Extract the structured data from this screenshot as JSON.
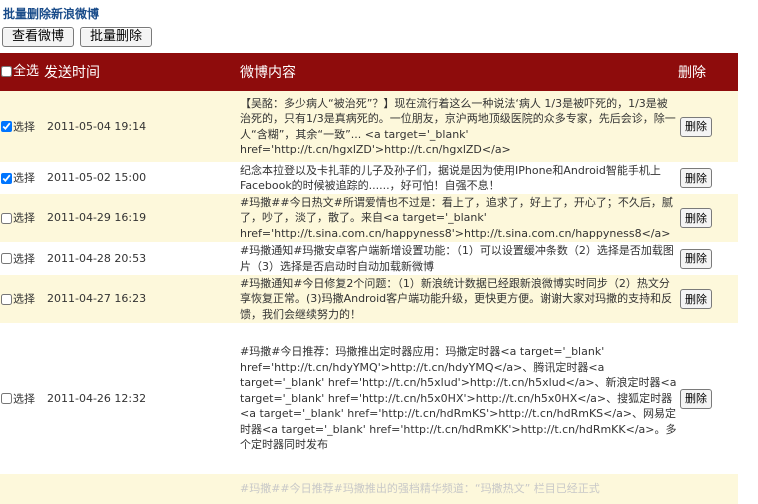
{
  "page": {
    "title": "批量删除新浪微博"
  },
  "toolbar": {
    "view_label": "查看微博",
    "batch_delete_label": "批量删除"
  },
  "table": {
    "headers": {
      "select_all": "全选",
      "time": "发送时间",
      "content": "微博内容",
      "delete": "删除"
    },
    "select_label": "选择",
    "delete_label": "删除",
    "rows": [
      {
        "checked": true,
        "time": "2011-05-04 19:14",
        "content": "【吴酩：多少病人“被治死”？】现在流行着这么一种说法‘病人 1/3是被吓死的，1/3是被治死的，只有1/3是真病死的。一位朋友，京沪两地顶级医院的众多专家，先后会诊，除一人“含糊”，其余“一致”... <a target='_blank' href='http://t.cn/hgxlZD'>http://t.cn/hgxlZD</a>"
      },
      {
        "checked": true,
        "time": "2011-05-02 15:00",
        "content": "纪念本拉登以及卡扎菲的儿子及孙子们，据说是因为使用IPhone和Android智能手机上Facebook的时候被追踪的......，好可怕！自强不息！"
      },
      {
        "checked": false,
        "time": "2011-04-29 16:19",
        "content": "#玛撒##今日热文#所谓爱情也不过是：看上了，追求了，好上了，开心了；不久后，腻了，吵了，淡了，散了。来自<a target='_blank' href='http://t.sina.com.cn/happyness8'>http://t.sina.com.cn/happyness8</a>"
      },
      {
        "checked": false,
        "time": "2011-04-28 20:53",
        "content": "#玛撒通知#玛撒安卓客户端新增设置功能：（1）可以设置缓冲条数（2）选择是否加载图片（3）选择是否启动时自动加载新微博"
      },
      {
        "checked": false,
        "time": "2011-04-27 16:23",
        "content": "#玛撒通知#今日修复2个问题：（1）新浪统计数据已经跟新浪微博实时同步（2）热文分享恢复正常。(3)玛撒Android客户端功能升级，更快更方便。谢谢大家对玛撒的支持和反馈，我们会继续努力的！"
      },
      {
        "checked": false,
        "time": "2011-04-26 12:32",
        "content": "#玛撒#今日推荐：玛撒推出定时器应用：玛撒定时器<a target='_blank' href='http://t.cn/hdyYMQ'>http://t.cn/hdyYMQ</a>、腾讯定时器<a target='_blank' href='http://t.cn/h5xlud'>http://t.cn/h5xlud</a>、新浪定时器<a target='_blank' href='http://t.cn/h5x0HX'>http://t.cn/h5x0HX</a>、搜狐定时器<a target='_blank' href='http://t.cn/hdRmKS'>http://t.cn/hdRmKS</a>、网易定时器<a target='_blank' href='http://t.cn/hdRmKK'>http://t.cn/hdRmKK</a>。多个定时器同时发布"
      },
      {
        "checked": false,
        "time": "",
        "content": "#玛撒##今日推荐#玛撒推出的强档精华频道：“玛撒热文” 栏目已经正式"
      }
    ]
  },
  "colors": {
    "header_bg": "#8e0c0c",
    "odd_row_bg": "#fdf8db",
    "title_color": "#1a4c8a"
  }
}
